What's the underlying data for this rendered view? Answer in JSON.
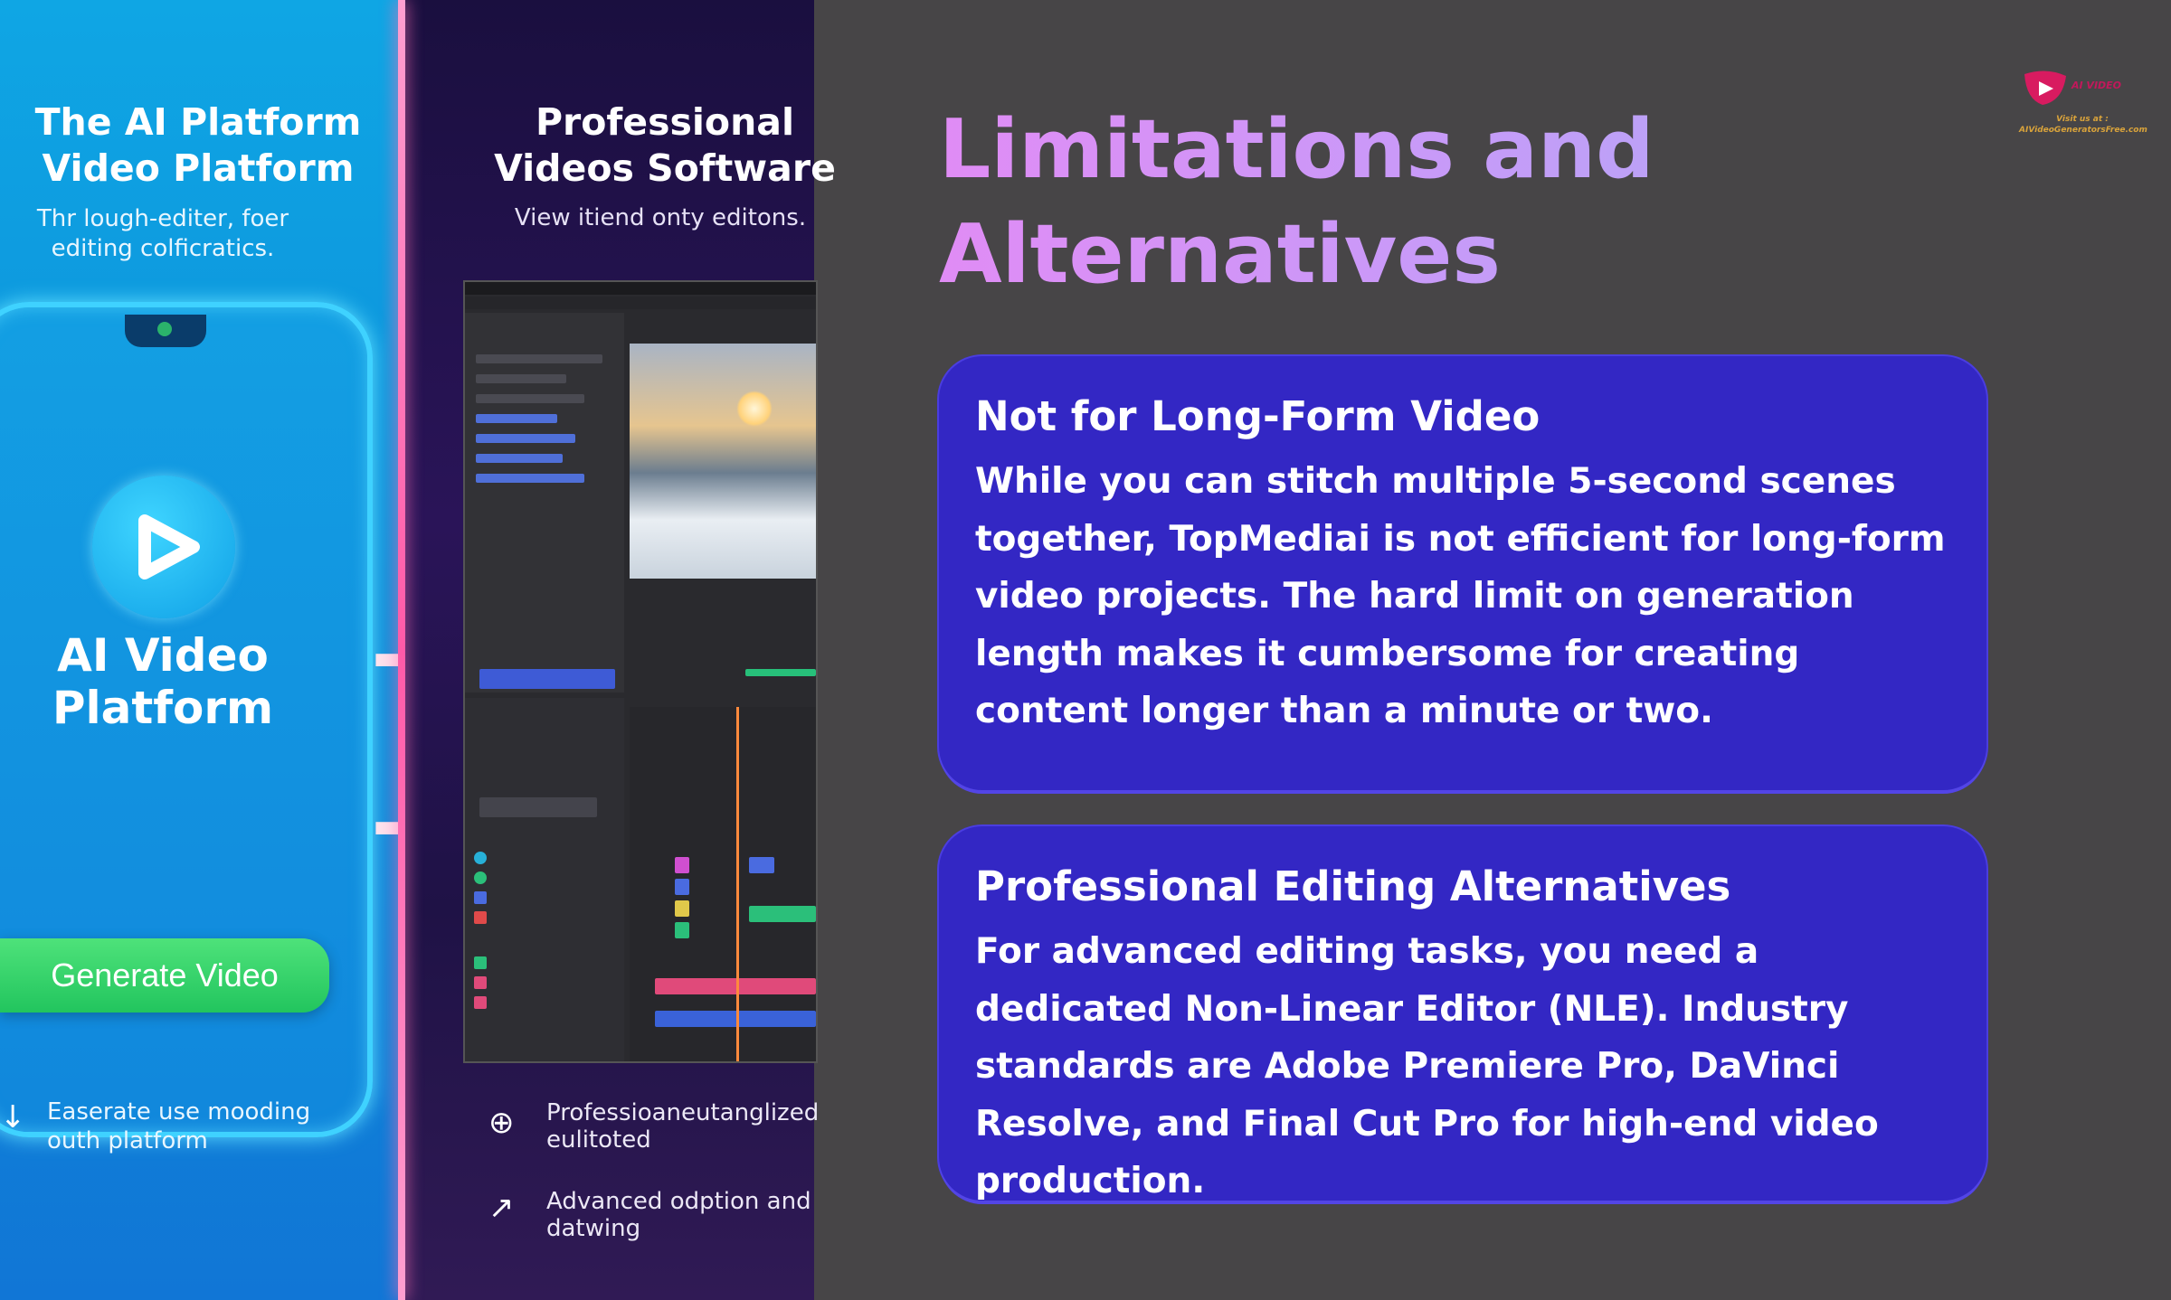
{
  "left_panel": {
    "title_line1": "The AI Platform",
    "title_line2": "Video Platform",
    "subtitle": "Thr lough-editer, foer editing colficratics.",
    "app_title_line1": "AI Video",
    "app_title_line2": "Platform",
    "generate_button": "Generate Video",
    "footer_text": "Easerate use mooding outh platform",
    "footer_icon": "arrow-down-icon"
  },
  "middle_panel": {
    "title_line1": "Professional",
    "title_line2": "Videos Software",
    "subtitle": "View itiend onty editons.",
    "feature1": "Professioaneutanglized eulitoted",
    "feature1_icon": "plus-circle-icon",
    "feature2": "Advanced odption and datwing",
    "feature2_icon": "arrow-up-right-icon"
  },
  "main": {
    "heading_line1": "Limitations and",
    "heading_line2": "Alternatives",
    "cards": [
      {
        "title": "Not for Long-Form Video",
        "body": "While you can stitch multiple 5-second scenes together, TopMediai is not efficient for long-form video projects. The hard limit on generation length makes it cumbersome for creating content longer than a minute or two."
      },
      {
        "title": "Professional Editing Alternatives",
        "body": "For advanced editing tasks, you need a dedicated Non-Linear Editor (NLE). Industry standards are Adobe Premiere Pro, DaVinci Resolve, and Final Cut Pro for high-end video production."
      }
    ]
  },
  "logo": {
    "name": "AI VIDEO",
    "visit_label": "Visit us at :",
    "url_text": "AIVideoGeneratorsFree.com"
  },
  "colors": {
    "background": "#474547",
    "card": "#3327c4",
    "heading_gradient_start": "#e08cf5",
    "heading_gradient_end": "#b7a4f6",
    "button": "#22c55e"
  }
}
